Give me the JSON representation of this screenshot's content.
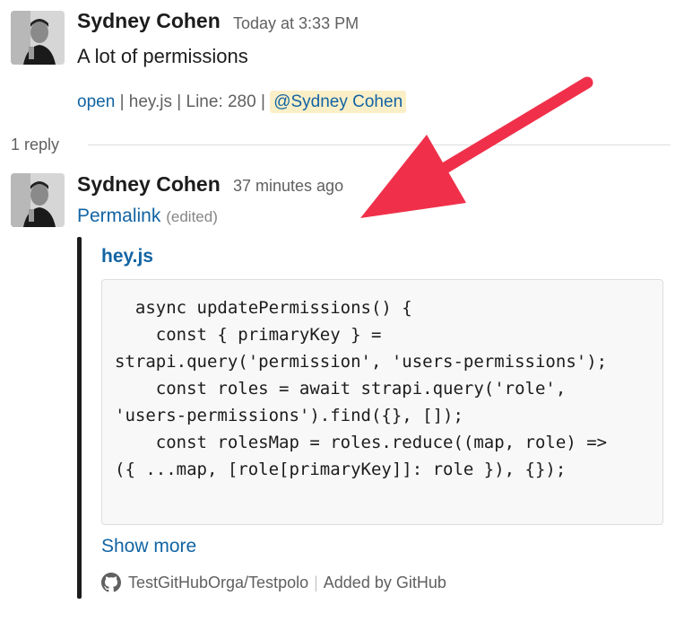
{
  "message": {
    "author": "Sydney Cohen",
    "timestamp": "Today at 3:33 PM",
    "text": "A lot of permissions",
    "meta": {
      "open_label": "open",
      "sep1": "|",
      "file": "hey.js",
      "sep2": "|",
      "line": "Line: 280",
      "sep3": "|",
      "mention": "@Sydney Cohen"
    }
  },
  "thread": {
    "reply_count": "1 reply"
  },
  "reply": {
    "author": "Sydney Cohen",
    "timestamp": "37 minutes ago",
    "permalink_label": "Permalink",
    "edited_label": "(edited)",
    "attachment": {
      "title": "hey.js",
      "code_lines": [
        "  async updatePermissions() {",
        "    const { primaryKey } =",
        "strapi.query('permission', 'users-permissions');",
        "    const roles = await strapi.query('role',",
        "'users-permissions').find({}, []);",
        "    const rolesMap = roles.reduce((map, role) =>",
        "({ ...map, [role[primaryKey]]: role }), {});"
      ],
      "show_more_label": "Show more",
      "source": "TestGitHubOrga/Testpolo",
      "source_sep": "|",
      "added_by": "Added by GitHub"
    }
  },
  "colors": {
    "link": "#1264a3",
    "mention_bg": "#fbefc7",
    "arrow": "#f0304a"
  }
}
